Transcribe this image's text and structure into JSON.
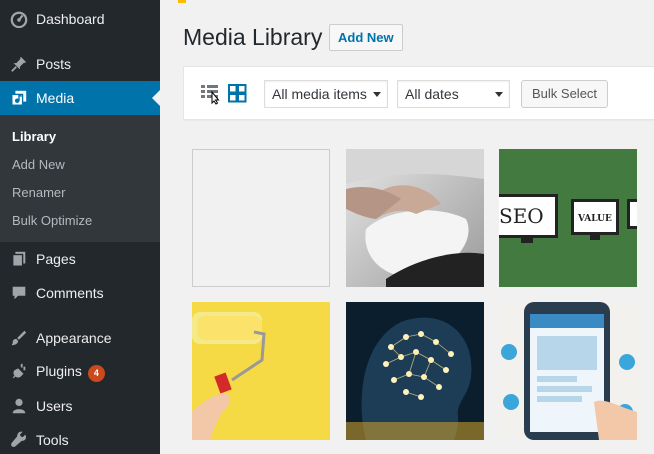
{
  "sidebar": {
    "items": [
      {
        "id": "dashboard",
        "label": "Dashboard",
        "icon": "dashboard-icon"
      },
      {
        "id": "posts",
        "label": "Posts",
        "icon": "pin-icon"
      },
      {
        "id": "media",
        "label": "Media",
        "icon": "media-icon",
        "active": true
      },
      {
        "id": "pages",
        "label": "Pages",
        "icon": "pages-icon"
      },
      {
        "id": "comments",
        "label": "Comments",
        "icon": "comment-icon"
      },
      {
        "id": "appearance",
        "label": "Appearance",
        "icon": "brush-icon"
      },
      {
        "id": "plugins",
        "label": "Plugins",
        "icon": "plug-icon",
        "badge": "4"
      },
      {
        "id": "users",
        "label": "Users",
        "icon": "user-icon"
      },
      {
        "id": "tools",
        "label": "Tools",
        "icon": "wrench-icon"
      }
    ],
    "submenu": [
      {
        "label": "Library",
        "current": true
      },
      {
        "label": "Add New"
      },
      {
        "label": "Renamer"
      },
      {
        "label": "Bulk Optimize"
      }
    ]
  },
  "header": {
    "title": "Media Library",
    "add_new_label": "Add New"
  },
  "toolbar": {
    "list_view_icon": "list-view-icon",
    "grid_view_icon": "grid-view-icon",
    "filter_type": "All media items",
    "filter_date": "All dates",
    "bulk_select_label": "Bulk Select"
  },
  "media_items": [
    {
      "name": "blank-image",
      "label": ""
    },
    {
      "name": "hand-on-mouse-photo",
      "label": ""
    },
    {
      "name": "seo-value-monitors",
      "label": "SEO",
      "label2": "VALUE"
    },
    {
      "name": "paint-roller-yellow-wall",
      "label": ""
    },
    {
      "name": "digital-brain-head",
      "label": ""
    },
    {
      "name": "mobile-phone-illustration",
      "label": ""
    }
  ],
  "colors": {
    "sidebar_bg": "#23282d",
    "submenu_bg": "#32373c",
    "active": "#0073aa",
    "badge": "#ca4a1f",
    "link": "#0073aa"
  }
}
